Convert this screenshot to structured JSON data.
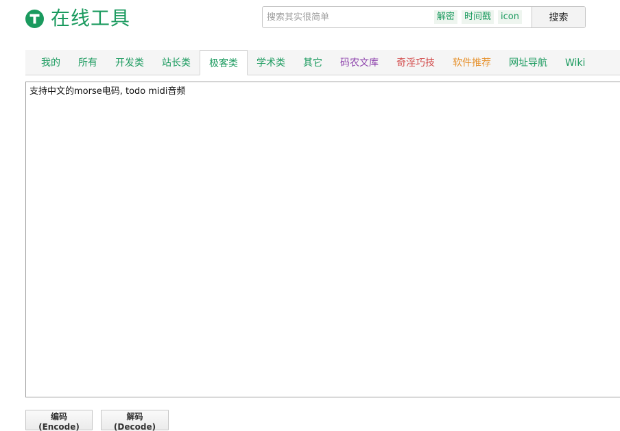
{
  "header": {
    "logo_text": "在线工具",
    "logo_color": "#1a9a5e"
  },
  "search": {
    "placeholder": "搜索其实很简单",
    "value": "",
    "quick_tags": [
      "解密",
      "时间戳",
      "icon"
    ],
    "button_label": "搜索"
  },
  "tabs": [
    {
      "label": "我的"
    },
    {
      "label": "所有"
    },
    {
      "label": "开发类"
    },
    {
      "label": "站长类"
    },
    {
      "label": "极客类",
      "active": true
    },
    {
      "label": "学术类"
    },
    {
      "label": "其它"
    },
    {
      "label": "码农文库"
    },
    {
      "label": "奇淫巧技"
    },
    {
      "label": "软件推荐"
    },
    {
      "label": "网址导航"
    },
    {
      "label": "Wiki"
    }
  ],
  "editor": {
    "value": "支持中文的morse电码, todo midi音频"
  },
  "actions": {
    "encode_label": "编码(Encode)",
    "decode_label": "解码(Decode)"
  },
  "colors": {
    "accent_green": "#1a9a5e",
    "tab_purple": "#8e44ad",
    "tab_red": "#d24b4b",
    "tab_orange": "#e6922e",
    "tab_bar_bg": "#f5f5f5"
  },
  "icons": {
    "logo": "t-circle-icon"
  }
}
